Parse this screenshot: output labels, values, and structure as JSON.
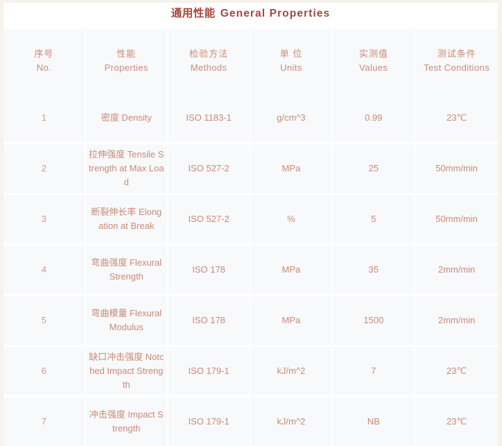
{
  "title": {
    "cn": "通用性能",
    "en": "General Properties"
  },
  "columns": [
    {
      "cn": "序号",
      "en": "No."
    },
    {
      "cn": "性能",
      "en": "Properties"
    },
    {
      "cn": "检验方法",
      "en": "Methods"
    },
    {
      "cn": "单 位",
      "en": "Units"
    },
    {
      "cn": "实测值",
      "en": "Values"
    },
    {
      "cn": "测试条件",
      "en": "Test Conditions"
    }
  ],
  "rows": [
    {
      "no": "1",
      "properties": "密度 Density",
      "properties_cn": "密度",
      "properties_en": "Density",
      "method": "ISO 1183-1",
      "unit": "g/cm^3",
      "value": "0.99",
      "condition": "23℃"
    },
    {
      "no": "2",
      "properties": "拉伸强度 Tensile Strength at Max Load",
      "properties_cn": "拉伸强度",
      "properties_en": "Tensile Strength at Max Load",
      "method": "ISO 527-2",
      "unit": "MPa",
      "value": "25",
      "condition": "50mm/min"
    },
    {
      "no": "3",
      "properties": "断裂伸长率 Elongation at Break",
      "properties_cn": "断裂伸长率",
      "properties_en": "Elongation at Break",
      "method": "ISO 527-2",
      "unit": "%",
      "value": "5",
      "condition": "50mm/min"
    },
    {
      "no": "4",
      "properties": "弯曲强度 Flexural Strength",
      "properties_cn": "弯曲强度",
      "properties_en": "Flexural Strength",
      "method": "ISO 178",
      "unit": "MPa",
      "value": "35",
      "condition": "2mm/min"
    },
    {
      "no": "5",
      "properties": "弯曲模量 Flexural Modulus",
      "properties_cn": "弯曲模量",
      "properties_en": "Flexural Modulus",
      "method": "ISO 178",
      "unit": "MPa",
      "value": "1500",
      "condition": "2mm/min"
    },
    {
      "no": "6",
      "properties": "缺口冲击强度 Notched Impact Strength",
      "properties_cn": "缺口冲击强度",
      "properties_en": "Notched Impact Strength",
      "method": "ISO 179-1",
      "unit": "kJ/m^2",
      "value": "7",
      "condition": "23℃"
    },
    {
      "no": "7",
      "properties": "冲击强度 Impact Strength",
      "properties_cn": "冲击强度",
      "properties_en": "Impact Strength",
      "method": "ISO 179-1",
      "unit": "kJ/m^2",
      "value": "NB",
      "condition": "23℃"
    }
  ],
  "colors": {
    "page_background": "#f6f2ec",
    "cell_background": "#f8f9fb",
    "gridline": "#ffffff",
    "title_text": "#a8453c",
    "header_text": "#cf9180",
    "body_text": "#cf9a87"
  }
}
